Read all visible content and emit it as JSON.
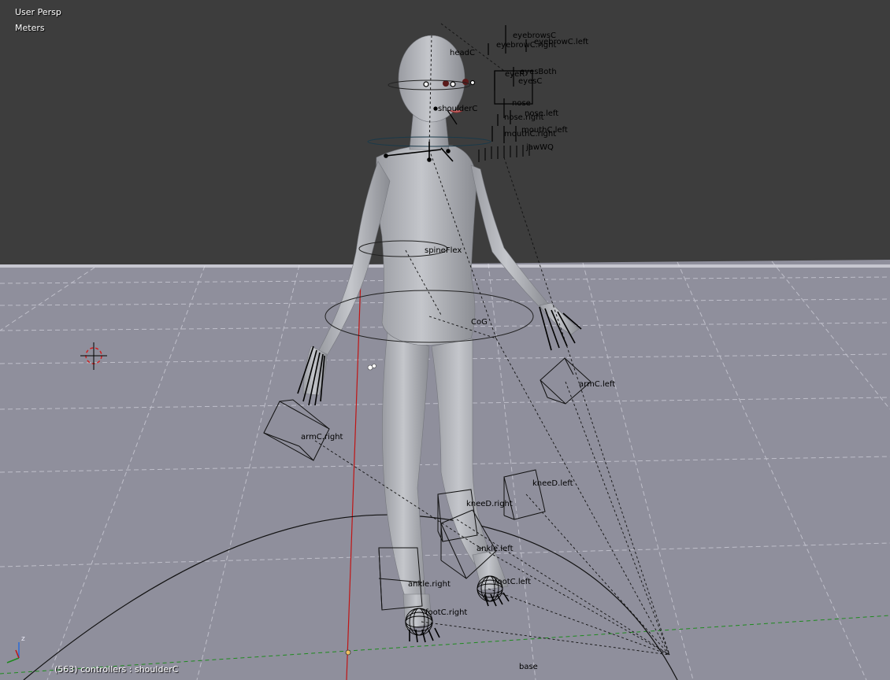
{
  "viewport": {
    "view_label": "User Persp",
    "units_label": "Meters",
    "status_line": "(563) controllers : shoulderC",
    "axis_x_label": "",
    "axis_z_label": "z"
  },
  "colors": {
    "background": "#3d3d3d",
    "floor": "#8f8f9c",
    "grid_line": "#ffffff",
    "x_axis": "#c01515",
    "y_axis": "#1e8a1e",
    "mesh": "#b7b9be",
    "bone": "#000000",
    "cursor": "#d02020"
  },
  "bones": {
    "eyebrowsC": "eyebrowsC",
    "eyebrowC_right": "eyebrowC.right",
    "eyebrowC_left": "eyebrowC.left",
    "headC": "headC",
    "eyesBoth": "eyesBoth",
    "eyeR": "eyeR",
    "eyesC": "eyesC",
    "shoulderC": "shoulderC",
    "nose": "nose",
    "nose_left": "nose.left",
    "nose_right": "nose.right",
    "mouthC_left": "mouthC.left",
    "mouthC_right": "mouthC.right",
    "jawWQ": "jawWQ",
    "spineFlex": "spineFlex",
    "CoG": "CoG",
    "armC_left": "armC.left",
    "armC_right": "armC.right",
    "kneeD_left": "kneeD.left",
    "kneeD_right": "kneeD.right",
    "ankle_left": "ankle.left",
    "ankle_right": "ankle.right",
    "footC_left": "footC.left",
    "footC_right": "footC.right",
    "base": "base"
  }
}
